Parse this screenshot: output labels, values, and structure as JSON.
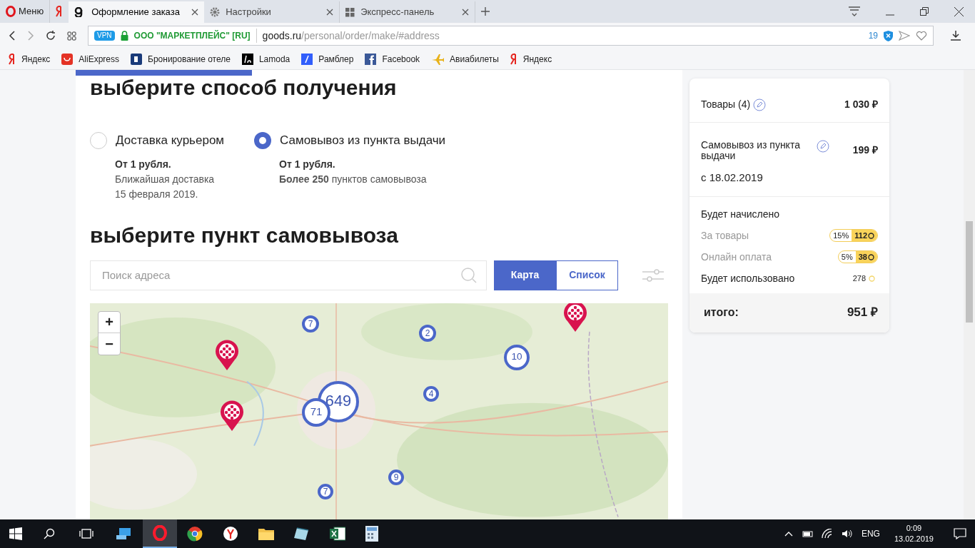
{
  "browser": {
    "menu": "Меню",
    "tabs": [
      {
        "label": "Оформление заказа",
        "selected": true
      },
      {
        "label": "Настройки",
        "selected": false
      },
      {
        "label": "Экспресс-панель",
        "selected": false
      }
    ],
    "address": {
      "vpn": "VPN",
      "site": "ООО \"МАРКЕТПЛЕЙС\" [RU]",
      "host": "goods.ru",
      "path": "/personal/order/make/#address",
      "blocked": "19"
    },
    "bookmarks": [
      {
        "label": "Яндекс"
      },
      {
        "label": "AliExpress"
      },
      {
        "label": "Бронирование отеле"
      },
      {
        "label": "Lamoda"
      },
      {
        "label": "Рамблер"
      },
      {
        "label": "Facebook"
      },
      {
        "label": "Авиабилеты"
      },
      {
        "label": "Яндекс"
      }
    ]
  },
  "page": {
    "progress": {
      "level": 0.29
    },
    "heading_delivery": "выберите способ получения",
    "delivery_options": [
      {
        "title": "Доставка курьером",
        "selected": false,
        "price": "От 1 рубля.",
        "details": [
          "Ближайшая доставка",
          "15 февраля 2019."
        ]
      },
      {
        "title": "Самовывоз из пункта выдачи",
        "selected": true,
        "price": "От 1 рубля.",
        "details": [
          "**Более 250** пунктов самовывоза"
        ]
      }
    ],
    "heading_pickup": "выберите пункт самовывоза",
    "search": {
      "placeholder": "Поиск адреса"
    },
    "view_toggle": [
      {
        "label": "Карта",
        "selected": true
      },
      {
        "label": "Список",
        "selected": false
      }
    ],
    "map": {
      "zoom_in": "+",
      "zoom_out": "−",
      "clusters": [
        {
          "count": "7"
        },
        {
          "count": "2"
        },
        {
          "count": "10"
        },
        {
          "count": "4"
        },
        {
          "count": "649"
        },
        {
          "count": "71"
        },
        {
          "count": "9"
        },
        {
          "count": "7"
        }
      ]
    }
  },
  "summary": {
    "items": {
      "label": "Товары (4)",
      "value": "1 030 ₽"
    },
    "shipping": {
      "label": "Самовывоз из пункта выдачи",
      "value": "199 ₽",
      "date": "с 18.02.2019"
    },
    "bonus_title": "Будет начислено",
    "bonuses": [
      {
        "label": "За товары",
        "percent": "15%",
        "points": "112"
      },
      {
        "label": "Онлайн оплата",
        "percent": "5%",
        "points": "38"
      }
    ],
    "used": {
      "label": "Будет использовано",
      "points": "278"
    },
    "total": {
      "label": "итого:",
      "value": "951 ₽"
    }
  },
  "taskbar": {
    "lang": "ENG",
    "time": "0:09",
    "date": "13.02.2019"
  }
}
